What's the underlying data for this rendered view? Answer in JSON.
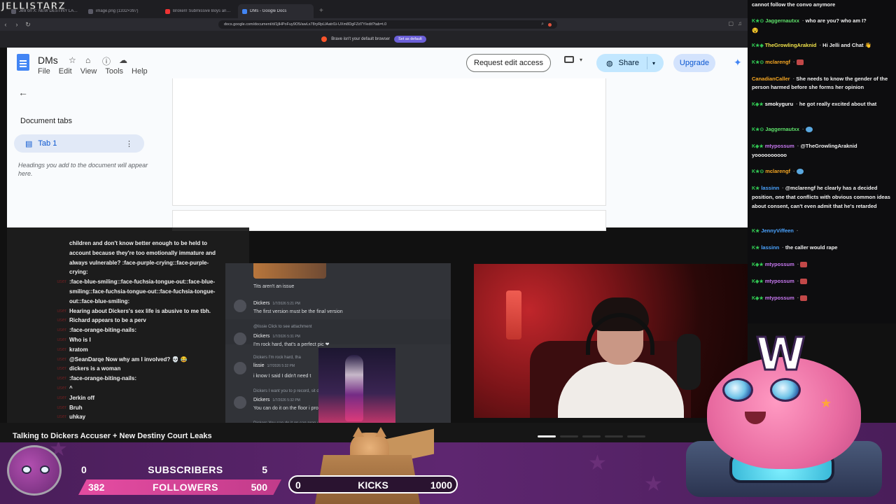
{
  "overlay_logo": "JELLISTARZ",
  "browser": {
    "tabs": [
      {
        "label": "Jelli on X: NEW DESTINY LAWS"
      },
      {
        "label": "image.png (1332×397)"
      },
      {
        "label": "Broken! Submissive Boys and the Sh"
      },
      {
        "label": "DMs - Google Docs",
        "active": true
      }
    ],
    "new_tab": "+",
    "url": "docs.google.com/document/d/1jlHPoFuy9O5/awLx78ryRpLlAatrl1i-UXm8DgFZd7Y/edit?tab=t.0",
    "notification": {
      "text": "Brave isn't your default browser",
      "button": "Set as default"
    }
  },
  "docs": {
    "title": "DMs",
    "menu": [
      "File",
      "Edit",
      "View",
      "Tools",
      "Help"
    ],
    "request_edit": "Request edit access",
    "share": "Share",
    "upgrade": "Upgrade",
    "sidebar": {
      "heading": "Document tabs",
      "tab": "Tab 1",
      "hint": "Headings you add to the document will appear here."
    }
  },
  "left_chat": [
    {
      "user": "",
      "text": "children and don't know better enough to be held to"
    },
    {
      "user": "",
      "text": "account because they're too emotionally immature and"
    },
    {
      "user": "",
      "text": "always vulnerable? :face-purple-crying::face-purple-"
    },
    {
      "user": "",
      "text": "crying:"
    },
    {
      "user": "user",
      "text": ":face-blue-smiling::face-fuchsia-tongue-out::face-blue-"
    },
    {
      "user": "",
      "text": "smiling::face-fuchsia-tongue-out::face-fuchsia-tongue-"
    },
    {
      "user": "",
      "text": "out::face-blue-smiling:"
    },
    {
      "user": "user",
      "text": "Hearing about Dickers's sex life is abusive to me tbh."
    },
    {
      "user": "user",
      "text": "Richard appears to be a perv"
    },
    {
      "user": "user",
      "text": ":face-orange-biting-nails:"
    },
    {
      "user": "user",
      "text": "Who is I"
    },
    {
      "user": "user",
      "text": "kratom"
    },
    {
      "user": "user",
      "text": "@SeanDarqe Now why am I involved? 💀 😂"
    },
    {
      "user": "user",
      "text": "dickers is a woman"
    },
    {
      "user": "user",
      "text": ":face-orange-biting-nails:"
    },
    {
      "user": "user",
      "text": "^"
    },
    {
      "user": "user",
      "text": "Jerkin off"
    },
    {
      "user": "user",
      "text": "Bruh"
    },
    {
      "user": "user",
      "text": "uhkay"
    }
  ],
  "discord": {
    "lines": [
      {
        "kind": "msg",
        "text": "Tits aren't an issue"
      },
      {
        "kind": "name",
        "text": "Dickers",
        "time": "1/7/2026 5:21 PM"
      },
      {
        "kind": "msg",
        "text": "The first version must be the final version"
      },
      {
        "kind": "reply",
        "text": "@lissie  Click to see attachment"
      },
      {
        "kind": "name",
        "text": "Dickers",
        "time": "1/7/2026 5:31 PM"
      },
      {
        "kind": "msg",
        "text": "I'm rock hard, that's a perfect pic ❤"
      },
      {
        "kind": "reply",
        "text": "Dickers  I'm rock hard, tha"
      },
      {
        "kind": "name",
        "text": "lissie",
        "time": "1/7/2026 5:32 PM"
      },
      {
        "kind": "msg",
        "text": "i know I said I didn't need t"
      },
      {
        "kind": "reply",
        "text": "Dickers  I want you to p            record, sit down, open yo"
      },
      {
        "kind": "name",
        "text": "Dickers",
        "time": "1/7/2026 5:32 PM"
      },
      {
        "kind": "msg",
        "text": "You can do it on the floor i              prop up your phone"
      },
      {
        "kind": "reply",
        "text": "Dickers  You can do it on                can prop up your phone"
      }
    ]
  },
  "right_chat": {
    "top": "cannot follow the convo anymore",
    "messages": [
      {
        "user": "Jaggernautxx",
        "color": "#5fe36b",
        "text": "who are you? who am I?",
        "badges": "K★⊙"
      },
      {
        "user": "",
        "color": "#5fe36b",
        "text": "😵",
        "badges": ""
      },
      {
        "user": "TheGrowlingAraknid",
        "color": "#f0e24a",
        "text": "Hi Jelli and Chat 👋",
        "badges": "K★◈"
      },
      {
        "user": "mclarengf",
        "color": "#f5a623",
        "text": "",
        "badges": "K★⊙",
        "emote": true
      },
      {
        "user": "CanadianCaller",
        "color": "#f5a623",
        "text": "She needs to know the gender of the person harmed before she forms her opinion",
        "badges": ""
      },
      {
        "user": "smokyguru",
        "color": "#ffffff",
        "text": "he got really excited about that",
        "badges": "K◈★"
      },
      {
        "user": "Jaggernautxx",
        "color": "#5fe36b",
        "text": "",
        "badges": "K★⊙",
        "emote2": true
      },
      {
        "user": "mtypossum",
        "color": "#c778f0",
        "text": "@TheGrowlingAraknid yoooooooooo",
        "badges": "K◈★"
      },
      {
        "user": "mclarengf",
        "color": "#f5a623",
        "text": "",
        "badges": "K★⊙",
        "emote2": true
      },
      {
        "user": "lassinn",
        "color": "#4aa3ff",
        "text": "@mclarengf he clearly has a decided position, one that conflicts with obvious common ideas about consent, can't even admit that he's retarded",
        "badges": "K★"
      },
      {
        "user": "JennyViffeen",
        "color": "#4aa3ff",
        "text": "",
        "badges": "K★"
      },
      {
        "user": "lassinn",
        "color": "#4aa3ff",
        "text": "the caller would rape",
        "badges": "K★"
      },
      {
        "user": "mtypossum",
        "color": "#c778f0",
        "text": "",
        "badges": "K◈★",
        "emote": true
      },
      {
        "user": "mtypossum",
        "color": "#c778f0",
        "text": "",
        "badges": "K◈★",
        "emote": true
      },
      {
        "user": "mtypossum",
        "color": "#c778f0",
        "text": "",
        "badges": "K◈★",
        "emote": true
      }
    ]
  },
  "stream_title": "Talking to Dickers Accuser + New Destiny Court Leaks",
  "goals": {
    "subscribers": {
      "current": "0",
      "label": "SUBSCRIBERS",
      "target": "5"
    },
    "followers": {
      "current": "382",
      "label": "FOLLOWERS",
      "target": "500"
    },
    "kicks": {
      "current": "0",
      "label": "KICKS",
      "target": "1000"
    }
  },
  "mascot_letter": "W",
  "colors": {
    "accent_purple": "#5e2670",
    "follow_pink": "#e34ba0",
    "docs_blue": "#0b57d0"
  }
}
